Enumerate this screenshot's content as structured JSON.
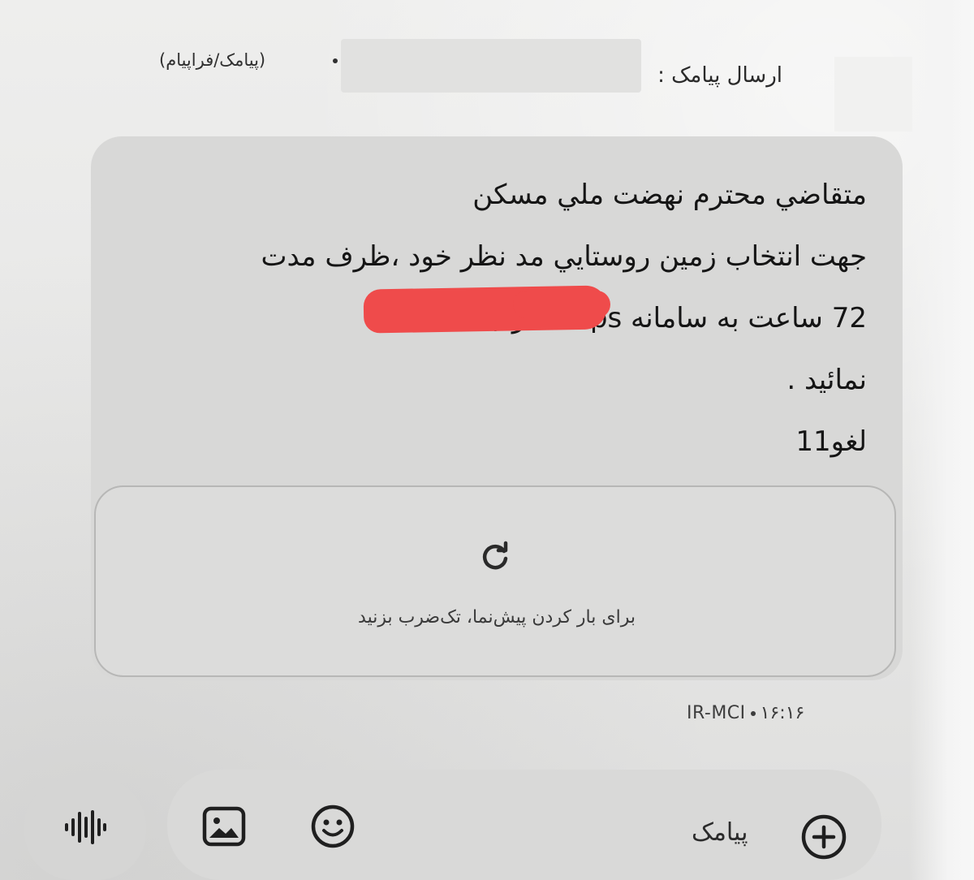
{
  "header": {
    "send_label": "ارسال پیامک :",
    "sim_info": "(پیامک/فراپیام)"
  },
  "message": {
    "lines": [
      "متقاضي محترم نهضت ملي مسكن",
      "جهت انتخاب زمين روستايي مد نظر خود ،ظرف مدت",
      "72 ساعت به سامانه https مراجعه",
      "نمائيد .",
      "لغو11"
    ],
    "redaction_color": "#ef4b4b"
  },
  "preview": {
    "icon": "refresh-icon",
    "text": "برای بار کردن پیش‌نما، تک‌ضرب بزنید"
  },
  "meta": {
    "sender": "IR-MCI",
    "time": "۱۶:۱۶"
  },
  "composer": {
    "placeholder": "پیامک",
    "icons": [
      "voice-icon",
      "gallery-icon",
      "emoji-icon",
      "add-icon"
    ]
  }
}
